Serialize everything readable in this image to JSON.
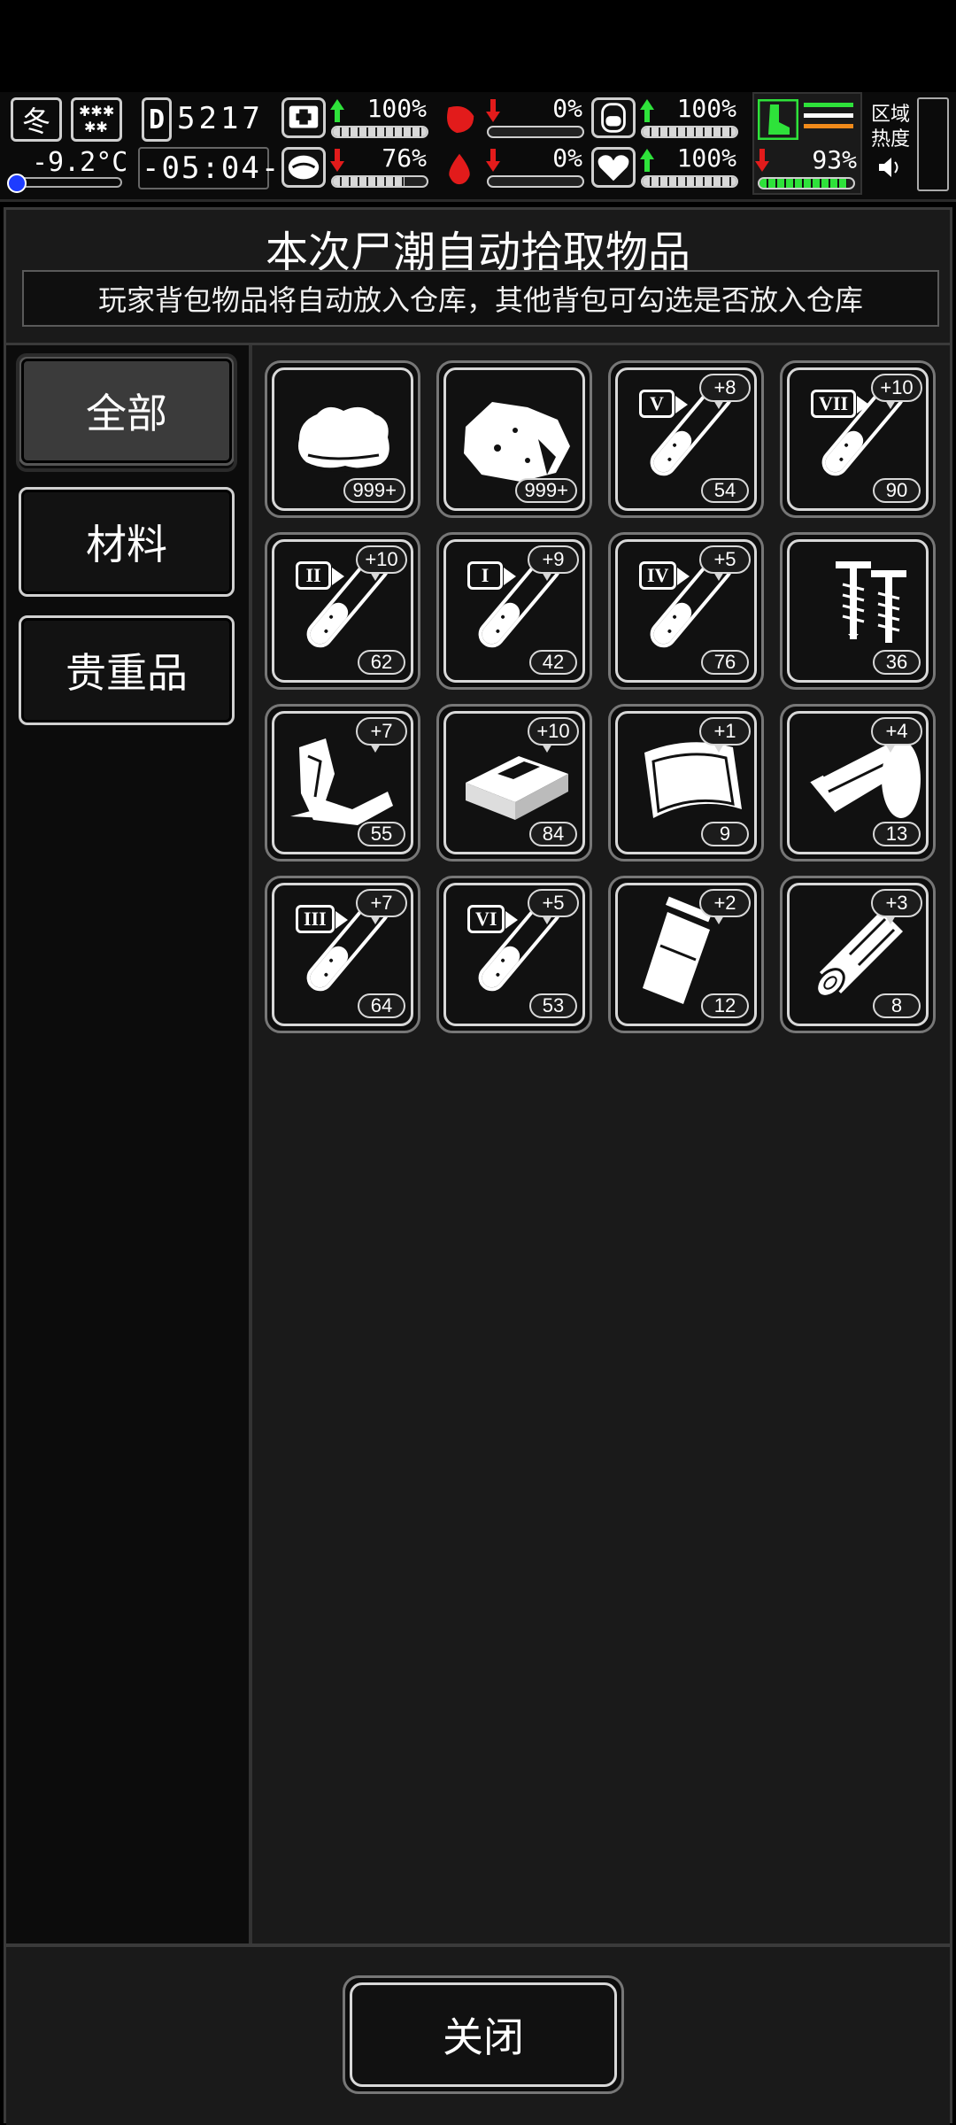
{
  "hud": {
    "season": "冬",
    "temperature": "-9.2°C",
    "day": "5217",
    "day_prefix": "D",
    "time": "-05:04-",
    "stats": [
      {
        "name": "health",
        "pct": "100%",
        "trend": "up",
        "fill": 1.0
      },
      {
        "name": "hunger",
        "pct": "0%",
        "trend": "down",
        "fill": 0.0
      },
      {
        "name": "energy",
        "pct": "100%",
        "trend": "up",
        "fill": 1.0
      },
      {
        "name": "mental",
        "pct": "76%",
        "trend": "down",
        "fill": 0.76
      },
      {
        "name": "thirst",
        "pct": "0%",
        "trend": "down",
        "fill": 0.0
      },
      {
        "name": "heart",
        "pct": "100%",
        "trend": "up",
        "fill": 1.0
      }
    ],
    "stamina_pct": "93%",
    "stamina_fill": 0.93,
    "region_heat_label": "区域热度",
    "colors": {
      "up": "#2ee23a",
      "down": "#e21b1b",
      "stamina": "#2ee23a"
    }
  },
  "dialog": {
    "title": "本次尸潮自动拾取物品",
    "subtitle": "玩家背包物品将自动放入仓库，其他背包可勾选是否放入仓库",
    "tabs": [
      {
        "label": "全部",
        "active": true
      },
      {
        "label": "材料",
        "active": false
      },
      {
        "label": "贵重品",
        "active": false
      }
    ],
    "items": [
      {
        "icon": "cloth-icon",
        "count": "999+",
        "badge": "",
        "roman": ""
      },
      {
        "icon": "ore-rock-icon",
        "count": "999+",
        "badge": "",
        "roman": ""
      },
      {
        "icon": "test-tube-icon",
        "count": "54",
        "badge": "+8",
        "roman": "V"
      },
      {
        "icon": "test-tube-icon",
        "count": "90",
        "badge": "+10",
        "roman": "VII"
      },
      {
        "icon": "test-tube-icon",
        "count": "62",
        "badge": "+10",
        "roman": "II"
      },
      {
        "icon": "test-tube-icon",
        "count": "42",
        "badge": "+9",
        "roman": "I"
      },
      {
        "icon": "test-tube-icon",
        "count": "76",
        "badge": "+5",
        "roman": "IV"
      },
      {
        "icon": "screws-icon",
        "count": "36",
        "badge": "",
        "roman": ""
      },
      {
        "icon": "scrap-metal-icon",
        "count": "55",
        "badge": "+7",
        "roman": ""
      },
      {
        "icon": "metal-ingot-icon",
        "count": "84",
        "badge": "+10",
        "roman": ""
      },
      {
        "icon": "leather-icon",
        "count": "9",
        "badge": "+1",
        "roman": ""
      },
      {
        "icon": "wood-planks-icon",
        "count": "13",
        "badge": "+4",
        "roman": ""
      },
      {
        "icon": "test-tube-icon",
        "count": "64",
        "badge": "+7",
        "roman": "III"
      },
      {
        "icon": "test-tube-icon",
        "count": "53",
        "badge": "+5",
        "roman": "VI"
      },
      {
        "icon": "pouch-icon",
        "count": "12",
        "badge": "+2",
        "roman": ""
      },
      {
        "icon": "log-icon",
        "count": "8",
        "badge": "+3",
        "roman": ""
      }
    ],
    "close_label": "关闭"
  }
}
